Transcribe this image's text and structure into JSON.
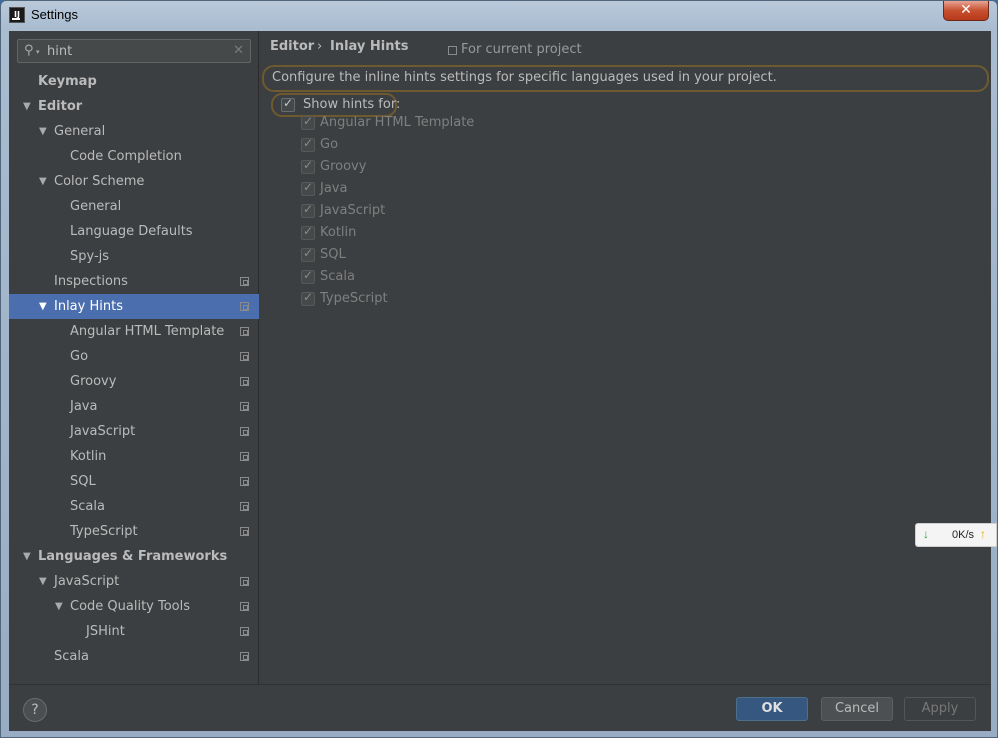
{
  "window": {
    "title": "Settings",
    "app_icon": "IJ",
    "close": "✕"
  },
  "search": {
    "value": "hint"
  },
  "tree": [
    {
      "label": "Keymap",
      "level": 0,
      "bold": true,
      "expandable": false,
      "project": false
    },
    {
      "label": "Editor",
      "level": 0,
      "bold": true,
      "expandable": true,
      "project": false
    },
    {
      "label": "General",
      "level": 1,
      "bold": false,
      "expandable": true,
      "project": false
    },
    {
      "label": "Code Completion",
      "level": 2,
      "bold": false,
      "expandable": false,
      "project": false
    },
    {
      "label": "Color Scheme",
      "level": 1,
      "bold": false,
      "expandable": true,
      "project": false
    },
    {
      "label": "General",
      "level": 2,
      "bold": false,
      "expandable": false,
      "project": false
    },
    {
      "label": "Language Defaults",
      "level": 2,
      "bold": false,
      "expandable": false,
      "project": false
    },
    {
      "label": "Spy-js",
      "level": 2,
      "bold": false,
      "expandable": false,
      "project": false
    },
    {
      "label": "Inspections",
      "level": 1,
      "bold": false,
      "expandable": false,
      "project": true
    },
    {
      "label": "Inlay Hints",
      "level": 1,
      "bold": false,
      "expandable": true,
      "project": true,
      "selected": true
    },
    {
      "label": "Angular HTML Template",
      "level": 2,
      "bold": false,
      "expandable": false,
      "project": true
    },
    {
      "label": "Go",
      "level": 2,
      "bold": false,
      "expandable": false,
      "project": true
    },
    {
      "label": "Groovy",
      "level": 2,
      "bold": false,
      "expandable": false,
      "project": true
    },
    {
      "label": "Java",
      "level": 2,
      "bold": false,
      "expandable": false,
      "project": true
    },
    {
      "label": "JavaScript",
      "level": 2,
      "bold": false,
      "expandable": false,
      "project": true
    },
    {
      "label": "Kotlin",
      "level": 2,
      "bold": false,
      "expandable": false,
      "project": true
    },
    {
      "label": "SQL",
      "level": 2,
      "bold": false,
      "expandable": false,
      "project": true
    },
    {
      "label": "Scala",
      "level": 2,
      "bold": false,
      "expandable": false,
      "project": true
    },
    {
      "label": "TypeScript",
      "level": 2,
      "bold": false,
      "expandable": false,
      "project": true
    },
    {
      "label": "Languages & Frameworks",
      "level": 0,
      "bold": true,
      "expandable": true,
      "project": false
    },
    {
      "label": "JavaScript",
      "level": 1,
      "bold": false,
      "expandable": true,
      "project": true
    },
    {
      "label": "Code Quality Tools",
      "level": 2,
      "bold": false,
      "expandable": true,
      "project": true
    },
    {
      "label": "JSHint",
      "level": 3,
      "bold": false,
      "expandable": false,
      "project": true
    },
    {
      "label": "Scala",
      "level": 1,
      "bold": false,
      "expandable": false,
      "project": true
    }
  ],
  "breadcrumb": {
    "parent": "Editor",
    "separator": "›",
    "current": "Inlay Hints"
  },
  "scope_label": "For current project",
  "description": "Configure the inline hints settings for specific languages used in your project.",
  "show_hints": {
    "label": "Show hints for:",
    "checked": true
  },
  "languages": [
    {
      "label": "Angular HTML Template",
      "checked": true
    },
    {
      "label": "Go",
      "checked": true
    },
    {
      "label": "Groovy",
      "checked": true
    },
    {
      "label": "Java",
      "checked": true
    },
    {
      "label": "JavaScript",
      "checked": true
    },
    {
      "label": "Kotlin",
      "checked": true
    },
    {
      "label": "SQL",
      "checked": true
    },
    {
      "label": "Scala",
      "checked": true
    },
    {
      "label": "TypeScript",
      "checked": true
    }
  ],
  "footer": {
    "help": "?",
    "ok": "OK",
    "cancel": "Cancel",
    "apply": "Apply"
  },
  "net_widget": {
    "rate": "0K/s",
    "down_icon": "↓",
    "up_icon": "↑"
  },
  "colors": {
    "background": "#3c3f41",
    "selection": "#4b6eaf",
    "ok_button": "#365880",
    "highlight_border": "#6e5a2e"
  }
}
